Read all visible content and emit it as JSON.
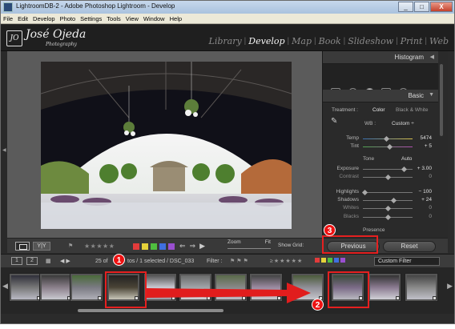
{
  "window": {
    "title": "LightroomDB-2 - Adobe Photoshop Lightroom - Develop",
    "buttons": {
      "minimize": "_",
      "maximize": "□",
      "close": "X"
    }
  },
  "menu": [
    "File",
    "Edit",
    "Develop",
    "Photo",
    "Settings",
    "Tools",
    "View",
    "Window",
    "Help"
  ],
  "identity": {
    "badge": "JO",
    "name": "José Ojeda",
    "subtitle": "Photography"
  },
  "modules": [
    {
      "label": "Library",
      "active": false
    },
    {
      "label": "Develop",
      "active": true
    },
    {
      "label": "Map",
      "active": false
    },
    {
      "label": "Book",
      "active": false
    },
    {
      "label": "Slideshow",
      "active": false
    },
    {
      "label": "Print",
      "active": false
    },
    {
      "label": "Web",
      "active": false
    }
  ],
  "module_separator": "|",
  "toolbar": {
    "yy": "Y|Y",
    "stars": "★★★★★",
    "nav_arrows": "⇐⇒▶",
    "zoom_label": "Zoom",
    "zoom_fit": "Fit",
    "grid_label": "Show Grid:",
    "swatches": [
      "#e23b3b",
      "#e5d23a",
      "#4fbf3f",
      "#3f6fe0",
      "#9a4fd0"
    ]
  },
  "right_panel": {
    "histogram": "Histogram",
    "basic": "Basic",
    "treatment_label": "Treatment :",
    "treatment_color": "Color",
    "treatment_bw": "Black & White",
    "wb_label": "WB :",
    "wb_value": "Custom ÷",
    "tone_label": "Tone",
    "auto_label": "Auto",
    "presence_label": "Presence",
    "adjustments": {
      "temp": {
        "label": "Temp",
        "value": "5474"
      },
      "tint": {
        "label": "Tint",
        "value": "+ 5"
      },
      "exposure": {
        "label": "Exposure",
        "value": "+ 3.00"
      },
      "contrast": {
        "label": "Contrast",
        "value": "0"
      },
      "highlights": {
        "label": "Highlights",
        "value": "− 100"
      },
      "shadows": {
        "label": "Shadows",
        "value": "+ 24"
      },
      "whites": {
        "label": "Whites",
        "value": "0"
      },
      "blacks": {
        "label": "Blacks",
        "value": "0"
      }
    }
  },
  "buttons": {
    "previous": "Previous",
    "reset": "Reset"
  },
  "filmstrip_header": {
    "page1": "1",
    "page2": "2",
    "grid_icon": "▦",
    "nav": "◀ ▶",
    "count_prefix": "25 of",
    "count_suffix": "tos / 1 selected / DSC_033",
    "filter_label": "Filter :",
    "filter_value": "Custom Filter"
  },
  "annotations": {
    "badge1": "1",
    "badge2": "2",
    "badge3": "3"
  }
}
